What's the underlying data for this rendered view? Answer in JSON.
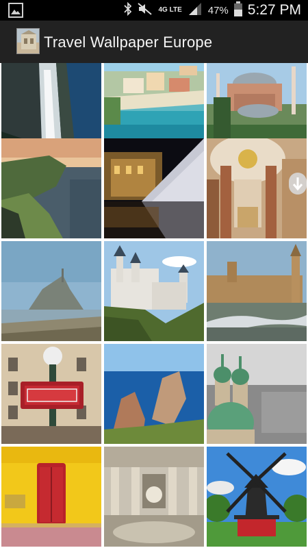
{
  "status_bar": {
    "battery_percent": "47%",
    "time": "5:27 PM",
    "network": "4G LTE",
    "icons": [
      "image-notification-icon",
      "bluetooth-icon",
      "mute-icon",
      "signal-icon",
      "battery-icon"
    ]
  },
  "app_bar": {
    "title": "Travel Wallpaper Europe",
    "logo_icon": "app-logo-icon"
  },
  "colors": {
    "status_bar": "#000000",
    "app_bar": "#222222",
    "title_text": "#f5f5f5"
  },
  "gallery": {
    "thumbnails": [
      {
        "subject": "waterfall-cliff"
      },
      {
        "subject": "coastal-village-bay"
      },
      {
        "subject": "hagia-sophia"
      },
      {
        "subject": "sea-cliffs-sunset"
      },
      {
        "subject": "louvre-pyramid-night"
      },
      {
        "subject": "baroque-church-interior"
      },
      {
        "subject": "mont-saint-michel"
      },
      {
        "subject": "neuschwanstein-castle"
      },
      {
        "subject": "westminster-big-ben"
      },
      {
        "subject": "paris-metro-sign"
      },
      {
        "subject": "coastal-rock-stacks"
      },
      {
        "subject": "church-domes-city"
      },
      {
        "subject": "yellow-wall-red-door"
      },
      {
        "subject": "trevi-fountain"
      },
      {
        "subject": "windmill-park"
      }
    ]
  },
  "fast_scroll_handle": "fast-scroll-handle-icon"
}
